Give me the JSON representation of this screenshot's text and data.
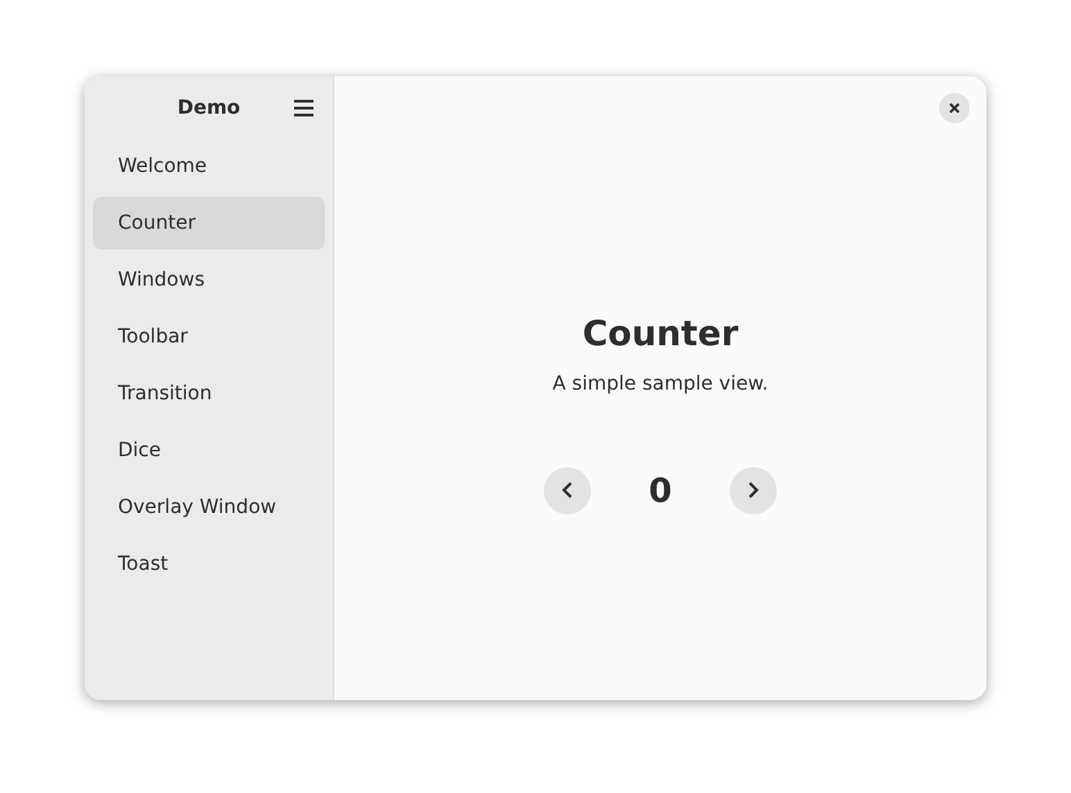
{
  "sidebar": {
    "title": "Demo",
    "items": [
      {
        "label": "Welcome",
        "selected": false
      },
      {
        "label": "Counter",
        "selected": true
      },
      {
        "label": "Windows",
        "selected": false
      },
      {
        "label": "Toolbar",
        "selected": false
      },
      {
        "label": "Transition",
        "selected": false
      },
      {
        "label": "Dice",
        "selected": false
      },
      {
        "label": "Overlay Window",
        "selected": false
      },
      {
        "label": "Toast",
        "selected": false
      }
    ]
  },
  "content": {
    "title": "Counter",
    "subtitle": "A simple sample view.",
    "value": "0"
  }
}
